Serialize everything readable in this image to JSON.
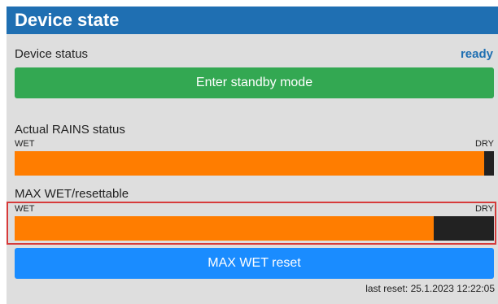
{
  "panel": {
    "title": "Device state"
  },
  "device_status": {
    "label": "Device status",
    "value": "ready",
    "value_color": "#1f6fb2"
  },
  "buttons": {
    "standby_label": "Enter standby mode",
    "standby_color": "#33a852",
    "reset_label": "MAX WET reset",
    "reset_color": "#1a8cff"
  },
  "rains_status": {
    "title": "Actual RAINS status",
    "scale_left": "WET",
    "scale_right": "DRY",
    "wet_level_fraction": 0.98
  },
  "max_wet": {
    "title": "MAX WET/resettable",
    "scale_left": "WET",
    "scale_right": "DRY",
    "wet_level_fraction": 0.875,
    "highlight_color": "#d63a3a"
  },
  "last_reset": {
    "label": "last reset:",
    "timestamp": "25.1.2023 12:22:05"
  },
  "colors": {
    "header_bg": "#1f6fb2",
    "panel_bg": "#dedede",
    "bar_fill": "#ff7d00",
    "bar_empty": "#222222"
  }
}
